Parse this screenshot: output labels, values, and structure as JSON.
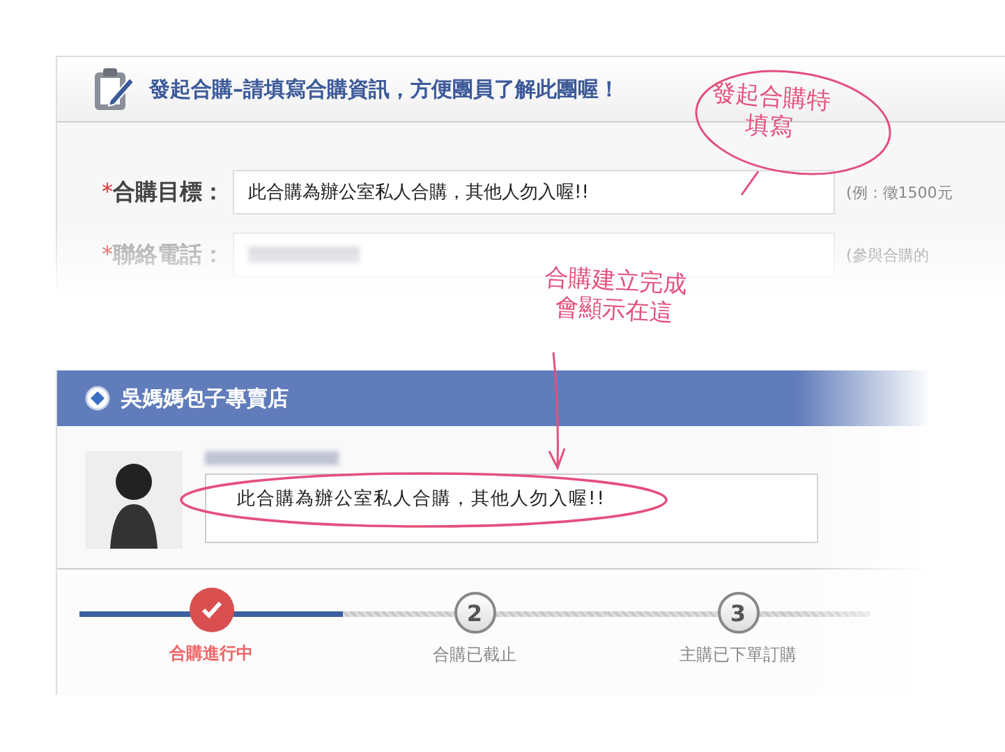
{
  "form_panel": {
    "title": "發起合購–請填寫合購資訊，方便團員了解此團喔！",
    "fields": [
      {
        "kind": "text",
        "label": "合購目標：",
        "required_mark": "*",
        "value": "此合購為辦公室私人合購，其他人勿入喔!!",
        "hint": "(例：徵1500元"
      },
      {
        "kind": "blurred",
        "label": "聯絡電話：",
        "required_mark": "*",
        "hint": "(參與合購的"
      }
    ]
  },
  "annotations": [
    {
      "lines": [
        "發起合購特",
        "填寫"
      ]
    },
    {
      "lines": [
        "合購建立完成",
        "會顯示在這"
      ]
    }
  ],
  "store_panel": {
    "title": "吳媽媽包子專賣店",
    "post": {
      "text": "此合購為辦公室私人合購，其他人勿入喔!!"
    }
  },
  "progress": {
    "steps": [
      {
        "label": "合購進行中",
        "selected": true
      },
      {
        "number": "2",
        "label": "合購已截止",
        "selected": false
      },
      {
        "number": "3",
        "label": "主購已下單訂購",
        "selected": false
      }
    ]
  }
}
